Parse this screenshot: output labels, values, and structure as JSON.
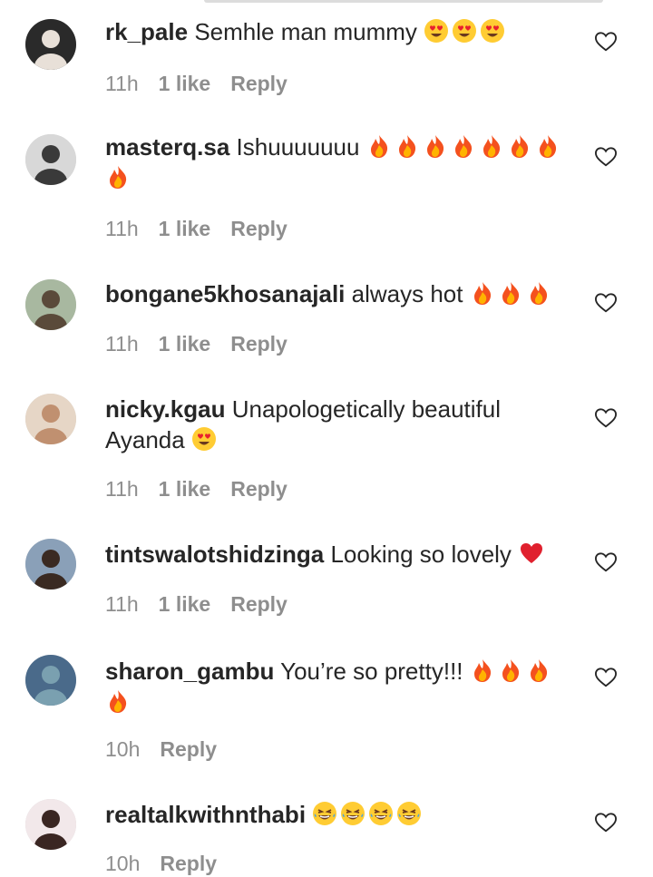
{
  "comments": [
    {
      "username": "rk_pale",
      "text": "Semhle man mummy",
      "emojis": [
        "heart-eyes",
        "heart-eyes",
        "heart-eyes"
      ],
      "time": "11h",
      "likes": "1 like",
      "reply": "Reply"
    },
    {
      "username": "masterq.sa",
      "text": "Ishuuuuuuu",
      "emojis": [
        "fire",
        "fire",
        "fire",
        "fire",
        "fire",
        "fire",
        "fire",
        "fire"
      ],
      "time": "11h",
      "likes": "1 like",
      "reply": "Reply"
    },
    {
      "username": "bongane5khosanajali",
      "text": "always hot",
      "emojis": [
        "fire",
        "fire",
        "fire"
      ],
      "time": "11h",
      "likes": "1 like",
      "reply": "Reply"
    },
    {
      "username": "nicky.kgau",
      "text": "Unapologetically beautiful Ayanda",
      "emojis": [
        "heart-eyes"
      ],
      "time": "11h",
      "likes": "1 like",
      "reply": "Reply"
    },
    {
      "username": "tintswalotshidzinga",
      "text": "Looking so lovely",
      "emojis": [
        "red-heart"
      ],
      "time": "11h",
      "likes": "1 like",
      "reply": "Reply"
    },
    {
      "username": "sharon_gambu",
      "text": "You’re so pretty!!!",
      "emojis": [
        "fire",
        "fire",
        "fire",
        "fire"
      ],
      "time": "10h",
      "likes": "",
      "reply": "Reply"
    },
    {
      "username": "realtalkwithnthabi",
      "text": "",
      "emojis": [
        "laughing",
        "laughing",
        "laughing",
        "laughing"
      ],
      "time": "10h",
      "likes": "",
      "reply": "Reply"
    }
  ],
  "icons": {
    "like": "heart-outline-icon",
    "accent_gray": "#8e8e8e",
    "text_dark": "#262626"
  }
}
